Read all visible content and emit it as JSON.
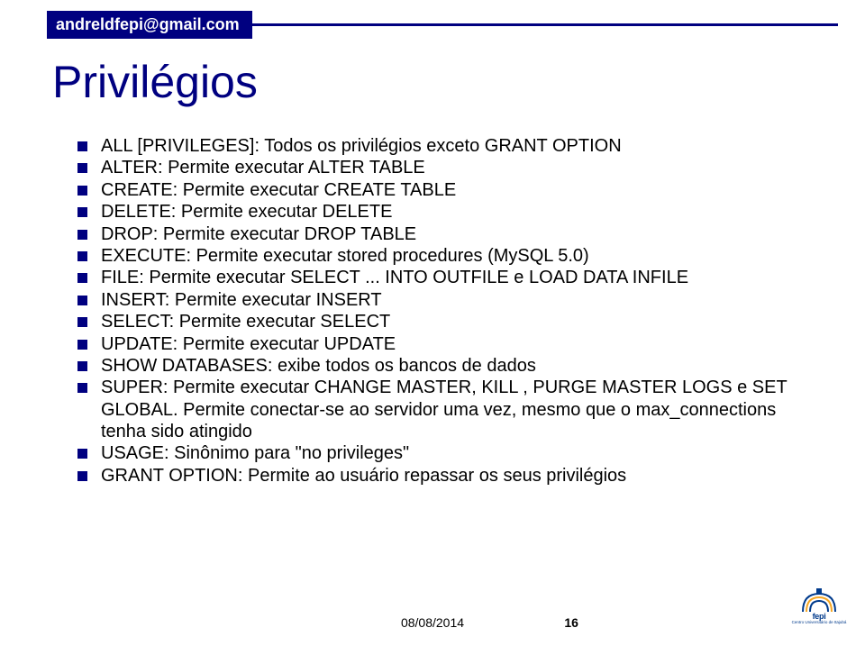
{
  "header": {
    "email": "andreldfepi@gmail.com"
  },
  "title": "Privilégios",
  "bullets": [
    "ALL [PRIVILEGES]: Todos os privilégios exceto GRANT OPTION",
    "ALTER: Permite executar ALTER TABLE",
    "CREATE: Permite executar CREATE TABLE",
    "DELETE: Permite executar DELETE",
    "DROP: Permite executar DROP TABLE",
    "EXECUTE: Permite executar stored procedures (MySQL 5.0)",
    "FILE: Permite executar SELECT ... INTO OUTFILE e LOAD DATA INFILE",
    "INSERT: Permite executar INSERT",
    "SELECT: Permite executar SELECT",
    "UPDATE: Permite executar UPDATE",
    "SHOW DATABASES: exibe todos os bancos de dados",
    "SUPER: Permite executar CHANGE MASTER, KILL , PURGE MASTER LOGS e SET GLOBAL. Permite conectar-se ao servidor uma vez, mesmo que o max_connections tenha sido atingido",
    "USAGE: Sinônimo para \"no privileges\"",
    "GRANT OPTION: Permite ao usuário repassar os seus privilégios"
  ],
  "footer": {
    "date": "08/08/2014",
    "page": "16",
    "logo_text": "fepi",
    "logo_sub": "Centro Universitário de Itajubá"
  }
}
